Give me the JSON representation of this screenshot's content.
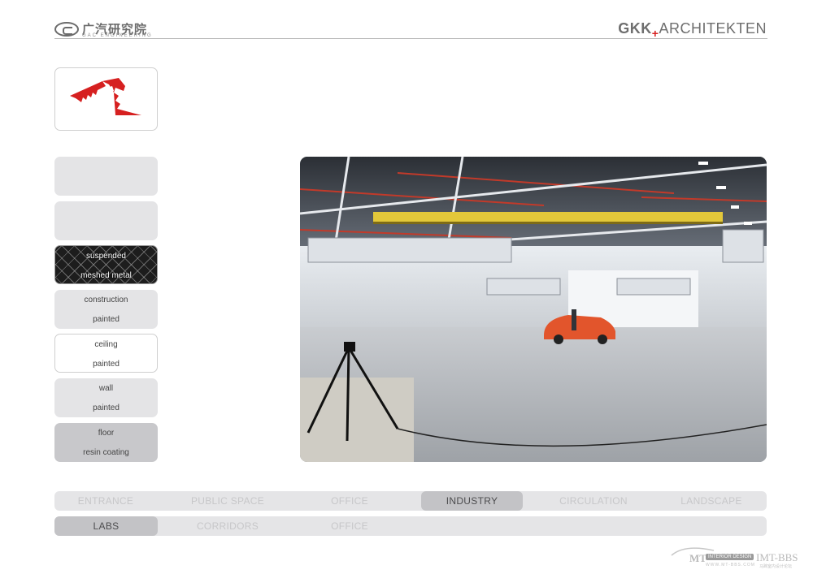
{
  "header": {
    "left_logo": {
      "cn": "广汽研究院",
      "en": "GAC ENGINEERING"
    },
    "right_logo": {
      "part1": "GKK",
      "plus": "+",
      "part2": "ARCHITEKTEN"
    }
  },
  "materials": [
    {
      "line1": "",
      "line2": "",
      "style": "plain"
    },
    {
      "line1": "",
      "line2": "",
      "style": "plain"
    },
    {
      "line1": "suspended",
      "line2": "meshed metal",
      "style": "mesh"
    },
    {
      "line1": "construction",
      "line2": "painted",
      "style": "plain"
    },
    {
      "line1": "ceiling",
      "line2": "painted",
      "style": "white"
    },
    {
      "line1": "wall",
      "line2": "painted",
      "style": "plain"
    },
    {
      "line1": "floor",
      "line2": "resin coating",
      "style": "grey"
    }
  ],
  "nav_primary": [
    "ENTRANCE",
    "PUBLIC SPACE",
    "OFFICE",
    "INDUSTRY",
    "CIRCULATION",
    "LANDSCAPE"
  ],
  "nav_primary_active": "INDUSTRY",
  "nav_secondary": [
    "LABS",
    "CORRIDORS",
    "OFFICE"
  ],
  "nav_secondary_active": "LABS",
  "watermark": {
    "mt": "MT",
    "pill": "INTERIOR DESIGN",
    "bbs": "IMT-BBS",
    "url": "WWW.MT-BBS.COM",
    "sub": "马蹄室内设计论坛"
  },
  "colors": {
    "accent_red": "#d62020",
    "active_tab": "#c3c3c6",
    "bar_bg": "#e5e5e7"
  }
}
